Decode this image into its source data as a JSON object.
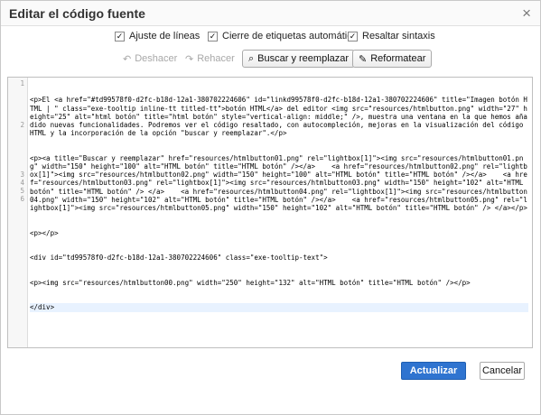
{
  "dialog": {
    "title": "Editar el código fuente",
    "close_glyph": "×"
  },
  "options": [
    {
      "label": "Ajuste de líneas",
      "checked": true
    },
    {
      "label": "Cierre de etiquetas automático",
      "checked": true
    },
    {
      "label": "Resaltar sintaxis",
      "checked": true
    }
  ],
  "toolbar": {
    "undo": {
      "label": "Deshacer",
      "enabled": false,
      "icon": "undo-icon"
    },
    "redo": {
      "label": "Rehacer",
      "enabled": false,
      "icon": "redo-icon"
    },
    "find": {
      "label": "Buscar y reemplazar",
      "icon": "find-replace-icon"
    },
    "format": {
      "label": "Reformatear",
      "icon": "reformat-icon"
    }
  },
  "editor": {
    "line_numbers": [
      "1",
      "2",
      "3",
      "4",
      "5",
      "6"
    ],
    "lines": [
      "<p>El <a href=\"#td99578f0-d2fc-b18d-12a1-380702224606\" id=\"linkd99578f0-d2fc-b18d-12a1-380702224606\" title=\"Imagen botón HTML | \" class=\"exe-tooltip inline-tt titled-tt\">botón HTML</a> del editor <img src=\"resources/htmlbutton.png\" width=\"27\" height=\"25\" alt=\"html botón\" title=\"html botón\" style=\"vertical-align: middle;\" />, muestra una ventana en la que hemos añadido nuevas funcionalidades. Podremos ver el código resaltado, con autocompleción, mejoras en la visualización del código HTML y la incorporación de la opción \"buscar y reemplazar\".</p>",
      "<p><a title=\"Buscar y reemplazar\" href=\"resources/htmlbutton01.png\" rel=\"lightbox[1]\"><img src=\"resources/htmlbutton01.png\" width=\"150\" height=\"100\" alt=\"HTML botón\" title=\"HTML botón\" /></a>    <a href=\"resources/htmlbutton02.png\" rel=\"lightbox[1]\"><img src=\"resources/htmlbutton02.png\" width=\"150\" height=\"100\" alt=\"HTML botón\" title=\"HTML botón\" /></a>    <a href=\"resources/htmlbutton03.png\" rel=\"lightbox[1]\"><img src=\"resources/htmlbutton03.png\" width=\"150\" height=\"102\" alt=\"HTML botón\" title=\"HTML botón\" /> </a>    <a href=\"resources/htmlbutton04.png\" rel=\"lightbox[1]\"><img src=\"resources/htmlbutton04.png\" width=\"150\" height=\"102\" alt=\"HTML botón\" title=\"HTML botón\" /></a>    <a href=\"resources/htmlbutton05.png\" rel=\"lightbox[1]\"><img src=\"resources/htmlbutton05.png\" width=\"150\" height=\"102\" alt=\"HTML botón\" title=\"HTML botón\" /> </a></p>",
      "<p></p>",
      "<div id=\"td99578f0-d2fc-b18d-12a1-380702224606\" class=\"exe-tooltip-text\">",
      "<p><img src=\"resources/htmlbutton00.png\" width=\"250\" height=\"132\" alt=\"HTML botón\" title=\"HTML botón\" /></p>",
      "</div>"
    ]
  },
  "footer": {
    "submit": "Actualizar",
    "cancel": "Cancelar"
  },
  "colors": {
    "primary_button": "#2f74d0"
  }
}
